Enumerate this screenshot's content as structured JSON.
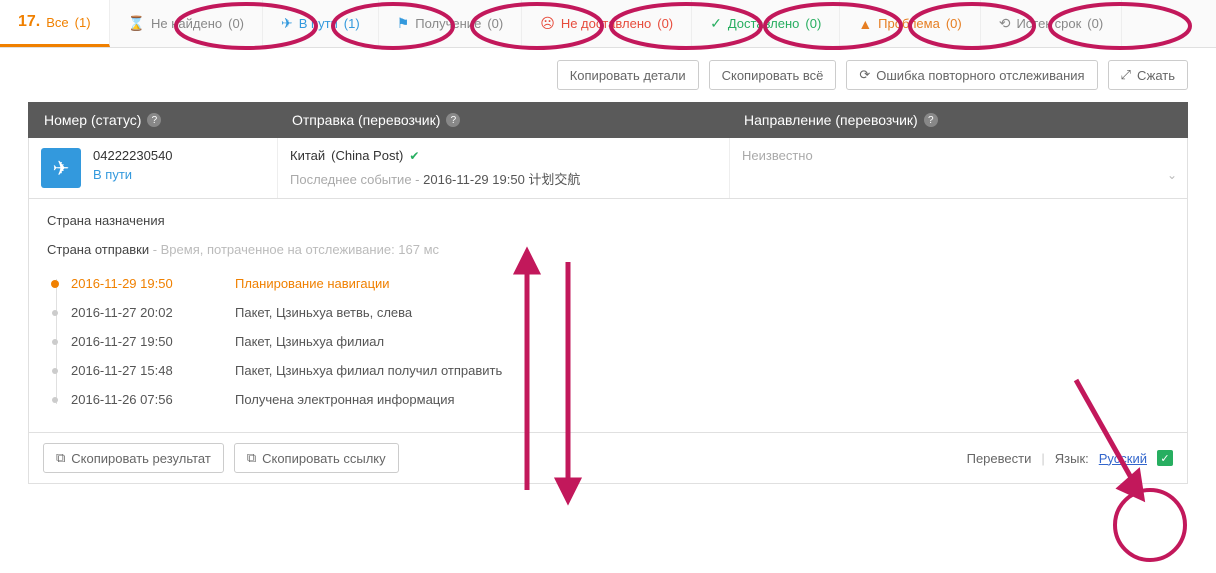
{
  "tabs": {
    "all": {
      "label": "Все",
      "count": "(1)"
    },
    "notfound": {
      "label": "Не найдено",
      "count": "(0)"
    },
    "intransit": {
      "label": "В пути",
      "count": "(1)"
    },
    "received": {
      "label": "Получение",
      "count": "(0)"
    },
    "undeliv": {
      "label": "Не доставлено",
      "count": "(0)"
    },
    "delivered": {
      "label": "Доставлено",
      "count": "(0)"
    },
    "problem": {
      "label": "Проблема",
      "count": "(0)"
    },
    "expired": {
      "label": "Истек срок",
      "count": "(0)"
    }
  },
  "toolbar": {
    "copy_details": "Копировать детали",
    "copy_all": "Скопировать всё",
    "retrack_error": "Ошибка повторного отслеживания",
    "collapse": "Сжать"
  },
  "headers": {
    "number": "Номер (статус)",
    "shipment": "Отправка (перевозчик)",
    "direction": "Направление (перевозчик)"
  },
  "track": {
    "number": "04222230540",
    "status": "В пути",
    "origin_country": "Китай",
    "origin_carrier": "(China Post)",
    "dest_carrier": "Неизвестно",
    "last_event_label": "Последнее событие -",
    "last_event_text": "2016-11-29 19:50 计划交航"
  },
  "details": {
    "dest_country_label": "Страна назначения",
    "origin_country_label": "Страна отправки",
    "origin_sub": " - Время, потраченное на отслеживание: 167 мс",
    "events": [
      {
        "time": "2016-11-29 19:50",
        "desc": "Планирование навигации"
      },
      {
        "time": "2016-11-27 20:02",
        "desc": "Пакет, Цзиньхуа ветвь, слева"
      },
      {
        "time": "2016-11-27 19:50",
        "desc": "Пакет, Цзиньхуа филиал"
      },
      {
        "time": "2016-11-27 15:48",
        "desc": "Пакет, Цзиньхуа филиал получил отправить"
      },
      {
        "time": "2016-11-26 07:56",
        "desc": "Получена электронная информация"
      }
    ]
  },
  "footer": {
    "copy_result": "Скопировать результат",
    "copy_link": "Скопировать ссылку",
    "translate": "Перевести",
    "language_label": "Язык:",
    "language_value": "Русский"
  }
}
